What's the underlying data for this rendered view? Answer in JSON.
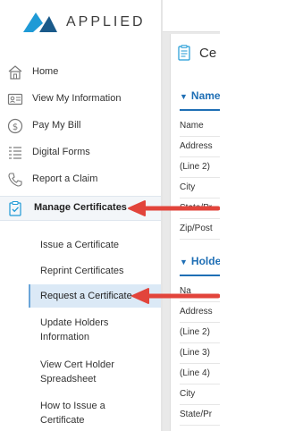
{
  "brand": {
    "logo_text": "APPLIED",
    "accent": "#1f9ad6",
    "arrow_color": "#e2443b"
  },
  "sidebar": {
    "items": [
      {
        "label": "Home",
        "icon": "home-icon"
      },
      {
        "label": "View My Information",
        "icon": "id-card-icon"
      },
      {
        "label": "Pay My Bill",
        "icon": "dollar-icon"
      },
      {
        "label": "Digital Forms",
        "icon": "form-list-icon"
      },
      {
        "label": "Report a Claim",
        "icon": "phone-icon"
      },
      {
        "label": "Manage Certificates",
        "icon": "clipboard-check-icon",
        "active": true
      }
    ],
    "sub_items": [
      {
        "label": "Issue a Certificate"
      },
      {
        "label": "Reprint Certificates"
      },
      {
        "label": "Request a Certificate",
        "active": true
      },
      {
        "label": "Update Holders Information"
      },
      {
        "label": "View Cert Holder Spreadsheet"
      },
      {
        "label": "How to Issue a Certificate"
      }
    ]
  },
  "main": {
    "title": "Ce",
    "section1": {
      "heading": "Name",
      "fields": [
        "Name",
        "Address",
        "(Line 2)",
        "City",
        "State/Pr",
        "Zip/Post"
      ]
    },
    "section2": {
      "heading": "Holde",
      "fields": [
        "Na",
        "Address",
        "(Line 2)",
        "(Line 3)",
        "(Line 4)",
        "City",
        "State/Pr"
      ]
    }
  }
}
